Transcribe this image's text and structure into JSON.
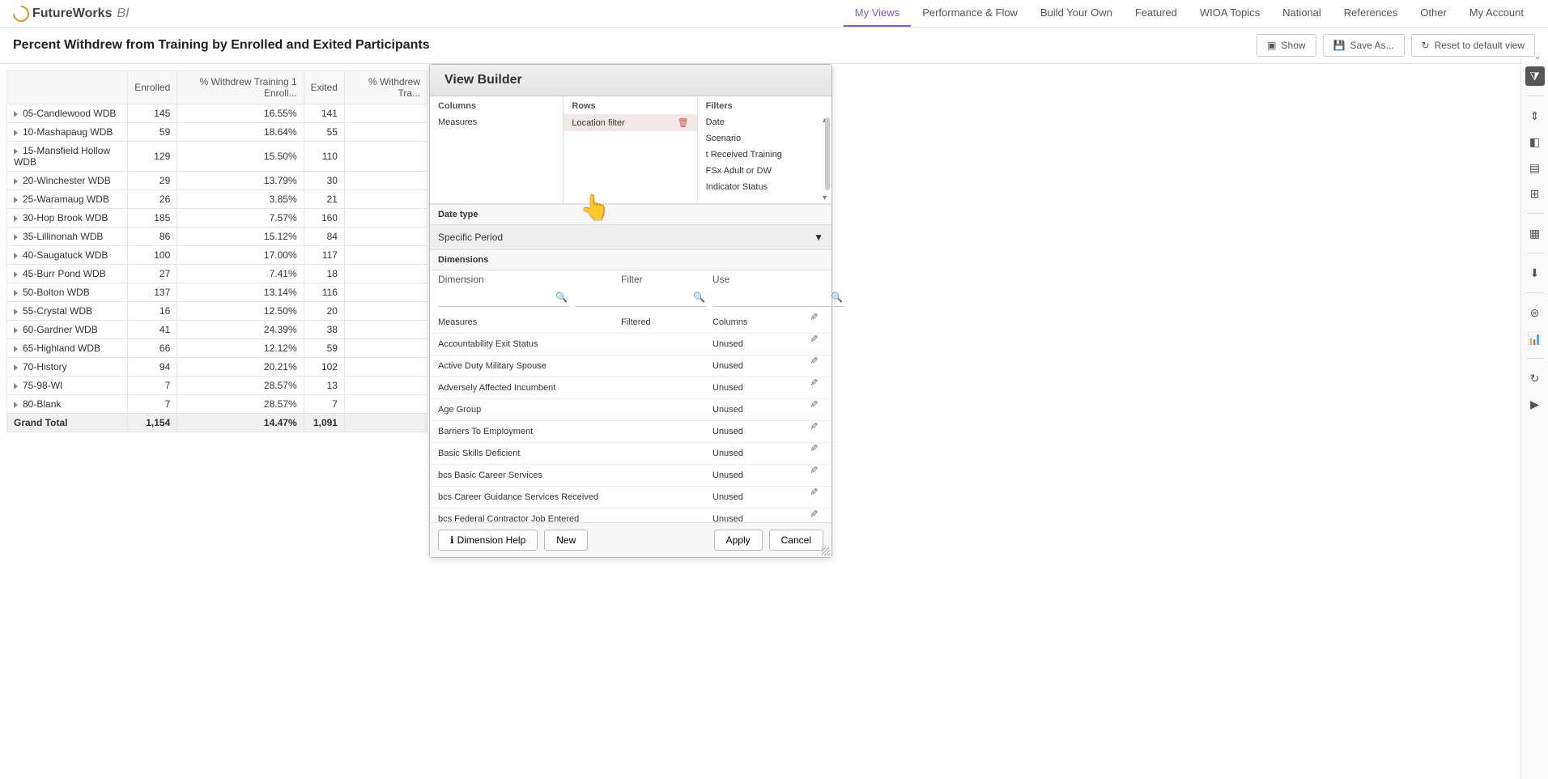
{
  "brand": {
    "name": "FutureWorks",
    "suffix": "BI"
  },
  "nav": {
    "items": [
      "My Views",
      "Performance & Flow",
      "Build Your Own",
      "Featured",
      "WIOA Topics",
      "National",
      "References",
      "Other",
      "My Account"
    ],
    "active": 0
  },
  "page": {
    "title": "Percent Withdrew from Training by Enrolled and Exited Participants"
  },
  "toolbar": {
    "show": "Show",
    "save_as": "Save As...",
    "reset": "Reset to default view"
  },
  "table": {
    "headers": [
      "",
      "Enrolled",
      "% Withdrew Training 1 Enroll...",
      "Exited",
      "% Withdrew Tra..."
    ],
    "rows": [
      {
        "label": "05-Candlewood WDB",
        "enrolled": "145",
        "pct": "16.55%",
        "exited": "141"
      },
      {
        "label": "10-Mashapaug WDB",
        "enrolled": "59",
        "pct": "18.64%",
        "exited": "55"
      },
      {
        "label": "15-Mansfield Hollow WDB",
        "enrolled": "129",
        "pct": "15.50%",
        "exited": "110"
      },
      {
        "label": "20-Winchester WDB",
        "enrolled": "29",
        "pct": "13.79%",
        "exited": "30"
      },
      {
        "label": "25-Waramaug WDB",
        "enrolled": "26",
        "pct": "3.85%",
        "exited": "21"
      },
      {
        "label": "30-Hop Brook WDB",
        "enrolled": "185",
        "pct": "7.57%",
        "exited": "160"
      },
      {
        "label": "35-Lillinonah WDB",
        "enrolled": "86",
        "pct": "15.12%",
        "exited": "84"
      },
      {
        "label": "40-Saugatuck WDB",
        "enrolled": "100",
        "pct": "17.00%",
        "exited": "117"
      },
      {
        "label": "45-Burr Pond WDB",
        "enrolled": "27",
        "pct": "7.41%",
        "exited": "18"
      },
      {
        "label": "50-Bolton WDB",
        "enrolled": "137",
        "pct": "13.14%",
        "exited": "116"
      },
      {
        "label": "55-Crystal WDB",
        "enrolled": "16",
        "pct": "12.50%",
        "exited": "20"
      },
      {
        "label": "60-Gardner WDB",
        "enrolled": "41",
        "pct": "24.39%",
        "exited": "38"
      },
      {
        "label": "65-Highland WDB",
        "enrolled": "66",
        "pct": "12.12%",
        "exited": "59"
      },
      {
        "label": "70-History",
        "enrolled": "94",
        "pct": "20.21%",
        "exited": "102"
      },
      {
        "label": "75-98-WI",
        "enrolled": "7",
        "pct": "28.57%",
        "exited": "13"
      },
      {
        "label": "80-Blank",
        "enrolled": "7",
        "pct": "28.57%",
        "exited": "7"
      }
    ],
    "grand": {
      "label": "Grand Total",
      "enrolled": "1,154",
      "pct": "14.47%",
      "exited": "1,091"
    }
  },
  "builder": {
    "title": "View Builder",
    "columns_label": "Columns",
    "rows_label": "Rows",
    "filters_label": "Filters",
    "columns_items": [
      "Measures"
    ],
    "rows_items": [
      "Location filter"
    ],
    "filters_items": [
      "Date",
      "Scenario",
      "t Received Training",
      "FSx Adult or DW",
      "Indicator Status"
    ],
    "date_type_label": "Date type",
    "date_type_value": "Specific Period",
    "dimensions_label": "Dimensions",
    "dim_headers": {
      "dimension": "Dimension",
      "filter": "Filter",
      "use": "Use"
    },
    "dim_rows": [
      {
        "name": "Measures",
        "filter": "Filtered",
        "use": "Columns"
      },
      {
        "name": "Accountability Exit Status",
        "filter": "",
        "use": "Unused"
      },
      {
        "name": "Active Duty Military Spouse",
        "filter": "",
        "use": "Unused"
      },
      {
        "name": "Adversely Affected Incumbent",
        "filter": "",
        "use": "Unused"
      },
      {
        "name": "Age Group",
        "filter": "",
        "use": "Unused"
      },
      {
        "name": "Barriers To Employment",
        "filter": "",
        "use": "Unused"
      },
      {
        "name": "Basic Skills Deficient",
        "filter": "",
        "use": "Unused"
      },
      {
        "name": "bcs Basic Career Services",
        "filter": "",
        "use": "Unused"
      },
      {
        "name": "bcs Career Guidance Services Received",
        "filter": "",
        "use": "Unused"
      },
      {
        "name": "bcs Federal Contractor Job Entered",
        "filter": "",
        "use": "Unused"
      }
    ],
    "help": "Dimension Help",
    "new_btn": "New",
    "apply": "Apply",
    "cancel": "Cancel"
  }
}
